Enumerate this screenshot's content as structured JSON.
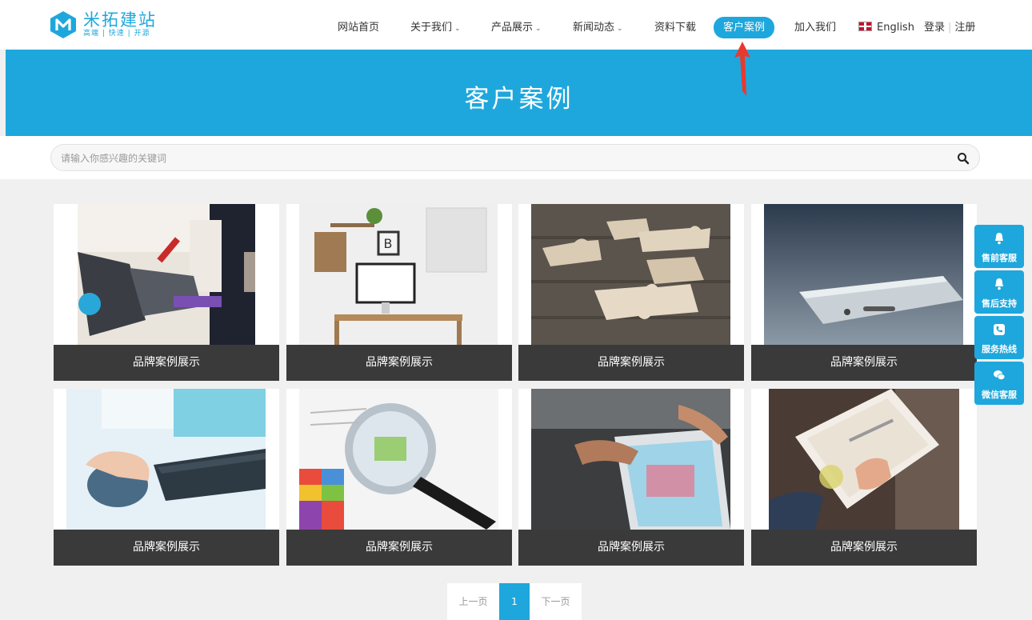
{
  "logo": {
    "name": "米拓建站",
    "slogan": "高端 | 快速 | 开源"
  },
  "nav": {
    "items": [
      {
        "label": "网站首页",
        "dropdown": false
      },
      {
        "label": "关于我们",
        "dropdown": true
      },
      {
        "label": "产品展示",
        "dropdown": true
      },
      {
        "label": "新闻动态",
        "dropdown": true
      },
      {
        "label": "资料下载",
        "dropdown": false
      },
      {
        "label": "客户案例",
        "dropdown": false,
        "active": true
      },
      {
        "label": "加入我们",
        "dropdown": false
      }
    ],
    "language": "English",
    "login": "登录",
    "register": "注册"
  },
  "banner": {
    "title": "客户案例"
  },
  "search": {
    "placeholder": "请输入你感兴趣的关键词"
  },
  "cases": [
    {
      "caption": "品牌案例展示",
      "image": "laptop-notes"
    },
    {
      "caption": "品牌案例展示",
      "image": "desk-workspace"
    },
    {
      "caption": "品牌案例展示",
      "image": "puzzle-pieces"
    },
    {
      "caption": "品牌案例展示",
      "image": "smartphone"
    },
    {
      "caption": "品牌案例展示",
      "image": "mouse-keyboard"
    },
    {
      "caption": "品牌案例展示",
      "image": "magnifier-chart"
    },
    {
      "caption": "品牌案例展示",
      "image": "tablet-hands"
    },
    {
      "caption": "品牌案例展示",
      "image": "tablet-reading"
    }
  ],
  "pager": {
    "prev": "上一页",
    "current": "1",
    "next": "下一页"
  },
  "side": [
    {
      "label": "售前客服",
      "icon": "bell-icon"
    },
    {
      "label": "售后支持",
      "icon": "bell-icon"
    },
    {
      "label": "服务热线",
      "icon": "phone-icon"
    },
    {
      "label": "微信客服",
      "icon": "wechat-icon"
    }
  ],
  "colors": {
    "accent": "#1ea7dc",
    "caption_bg": "#3a3a3a",
    "arrow": "#e8392f"
  }
}
